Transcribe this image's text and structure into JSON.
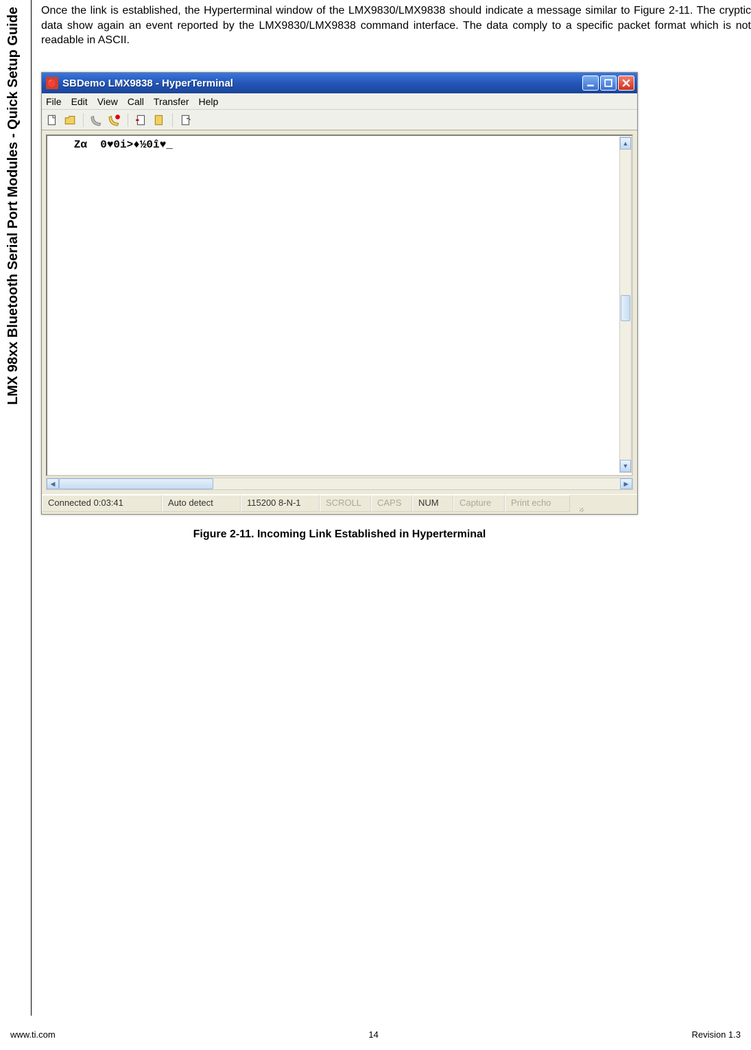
{
  "sidebarTitle": "LMX 98xx Bluetooth Serial Port Modules - Quick Setup Guide",
  "bodyText": "Once the link is established, the Hyperterminal window of the LMX9830/LMX9838 should indicate a message similar to Figure 2-11. The cryptic data show again an event reported by the LMX9830/LMX9838 command interface. The data comply to a specific packet format which is not readable in ASCII.",
  "window": {
    "title": "SBDemo LMX9838 - HyperTerminal",
    "menus": [
      "File",
      "Edit",
      "View",
      "Call",
      "Transfer",
      "Help"
    ],
    "terminalContent": "   Zα  0♥0i>♦½0î♥_",
    "status": {
      "connected": "Connected 0:03:41",
      "detect": "Auto detect",
      "baud": "115200 8-N-1",
      "scroll": "SCROLL",
      "caps": "CAPS",
      "num": "NUM",
      "capture": "Capture",
      "printecho": "Print echo"
    }
  },
  "figureCaption": "Figure 2-11.  Incoming Link Established in Hyperterminal",
  "footer": {
    "left": "www.ti.com",
    "center": "14",
    "right": "Revision 1.3"
  }
}
